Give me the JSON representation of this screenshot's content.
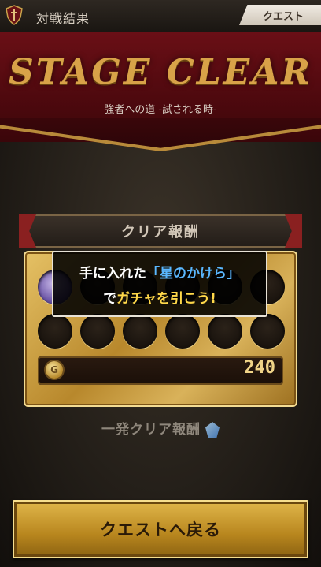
{
  "header": {
    "title": "対戦結果",
    "tab_label": "クエスト"
  },
  "banner": {
    "heading": "STAGE CLEAR",
    "subtitle": "強者への道 -試される時-"
  },
  "reward": {
    "header_label": "クリア報酬",
    "coin_value": "240",
    "coin_icon": "coin-icon"
  },
  "popup": {
    "line1_prefix": "手に入れた",
    "line1_highlight": "「星のかけら」",
    "line2_prefix": "で",
    "line2_highlight": "ガチャを引こう!"
  },
  "first_clear": {
    "label": "一発クリア報酬",
    "icon": "gem-icon"
  },
  "footer": {
    "back_button_label": "クエストへ戻る"
  },
  "colors": {
    "banner_red": "#6a0f16",
    "gold": "#d8a248",
    "highlight_blue": "#5ab7ff",
    "highlight_yellow": "#ffd84a"
  }
}
